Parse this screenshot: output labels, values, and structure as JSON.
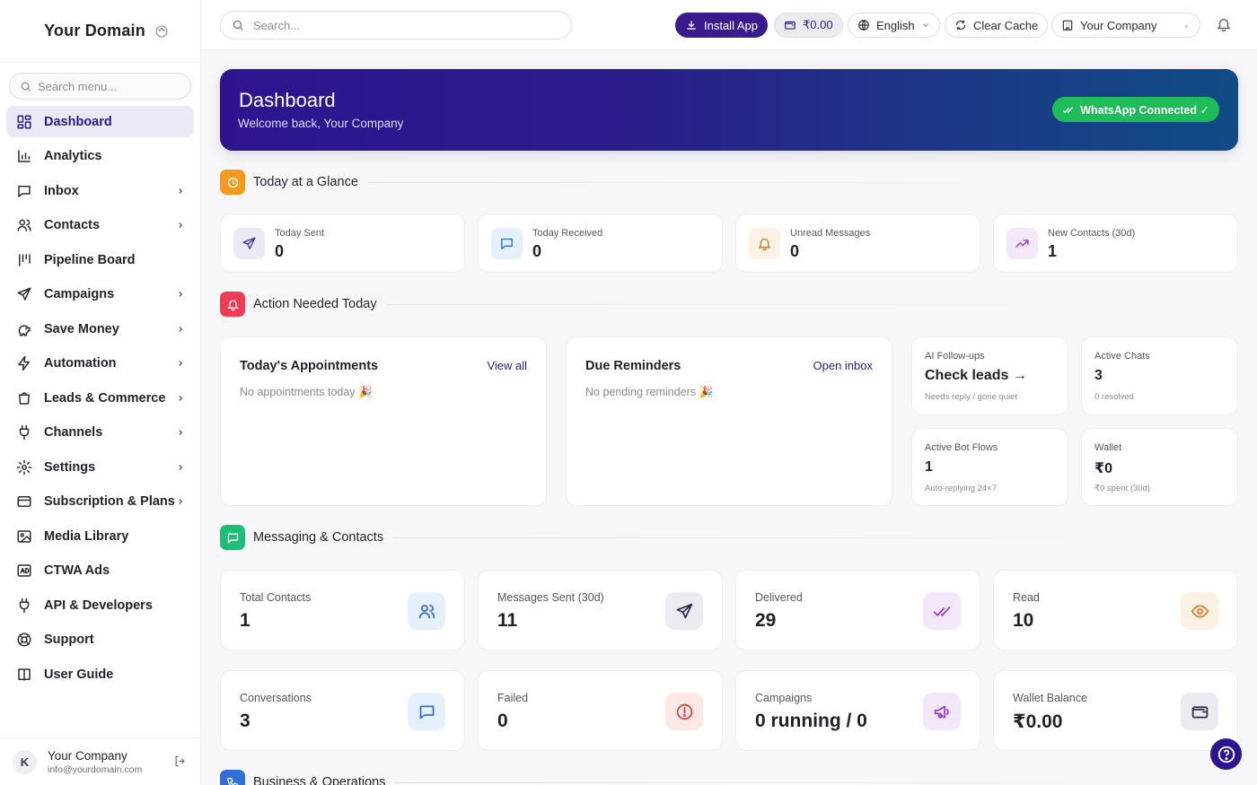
{
  "brand": {
    "name": "Your Domain"
  },
  "menu_search": {
    "placeholder": "Search menu..."
  },
  "nav": [
    {
      "label": "Dashboard",
      "icon": "dashboard-icon",
      "active": true,
      "chevron": false
    },
    {
      "label": "Analytics",
      "icon": "bar-chart-icon",
      "chevron": false
    },
    {
      "label": "Inbox",
      "icon": "chat-bubble-icon",
      "chevron": true
    },
    {
      "label": "Contacts",
      "icon": "users-icon",
      "chevron": true
    },
    {
      "label": "Pipeline Board",
      "icon": "pipeline-icon",
      "chevron": false
    },
    {
      "label": "Campaigns",
      "icon": "send-icon",
      "chevron": true
    },
    {
      "label": "Save Money",
      "icon": "piggy-bank-icon",
      "chevron": true
    },
    {
      "label": "Automation",
      "icon": "bolt-icon",
      "chevron": true
    },
    {
      "label": "Leads & Commerce",
      "icon": "shopping-bag-icon",
      "chevron": true
    },
    {
      "label": "Channels",
      "icon": "plug-icon",
      "chevron": true
    },
    {
      "label": "Settings",
      "icon": "gear-icon",
      "chevron": true
    },
    {
      "label": "Subscription & Plans",
      "icon": "credit-card-icon",
      "chevron": true
    },
    {
      "label": "Media Library",
      "icon": "image-icon",
      "chevron": false
    },
    {
      "label": "CTWA Ads",
      "icon": "ads-icon",
      "chevron": false
    },
    {
      "label": "API & Developers",
      "icon": "plug-icon",
      "chevron": false
    },
    {
      "label": "Support",
      "icon": "lifebuoy-icon",
      "chevron": false
    },
    {
      "label": "User Guide",
      "icon": "book-icon",
      "chevron": false
    }
  ],
  "user": {
    "initial": "K",
    "name": "Your Company",
    "email": "info@yourdomain.com"
  },
  "topbar": {
    "search_placeholder": "Search...",
    "install_label": "Install App",
    "wallet_label": "₹0.00",
    "language_label": "English",
    "clear_cache_label": "Clear Cache",
    "company_label": "Your Company"
  },
  "hero": {
    "title": "Dashboard",
    "subtitle": "Welcome back, Your Company",
    "badge": "WhatsApp Connected ✓"
  },
  "sections": {
    "glance": "Today at a Glance",
    "action": "Action Needed Today",
    "messaging": "Messaging & Contacts",
    "business": "Business & Operations"
  },
  "glance_cards": [
    {
      "label": "Today Sent",
      "value": "0",
      "icon": "send-icon",
      "color": "#4b3a9a",
      "bg": "#ebe9f5"
    },
    {
      "label": "Today Received",
      "value": "0",
      "icon": "chat-bubble-icon",
      "color": "#2f6fd6",
      "bg": "#e6effc"
    },
    {
      "label": "Unread Messages",
      "value": "0",
      "icon": "bell-icon",
      "color": "#e07a1f",
      "bg": "#fdf0e4"
    },
    {
      "label": "New Contacts (30d)",
      "value": "1",
      "icon": "trend-up-icon",
      "color": "#9b3ad6",
      "bg": "#f3e8fb"
    }
  ],
  "appointments": {
    "title": "Today's Appointments",
    "link": "View all",
    "empty": "No appointments today 🎉"
  },
  "reminders": {
    "title": "Due Reminders",
    "link": "Open inbox",
    "empty": "No pending reminders 🎉"
  },
  "mini_cards": [
    {
      "label": "AI Follow-ups",
      "value": "Check leads →",
      "sub": "Needs reply / gone quiet"
    },
    {
      "label": "Active Chats",
      "value": "3",
      "sub": "0 resolved"
    },
    {
      "label": "Active Bot Flows",
      "value": "1",
      "sub": "Auto-replying 24×7"
    },
    {
      "label": "Wallet",
      "value": "₹0",
      "sub": "₹0 spent (30d)"
    }
  ],
  "stat_cards": [
    {
      "label": "Total Contacts",
      "value": "1",
      "icon": "users-icon",
      "color": "#2f6fd6",
      "bg": "#e6effc"
    },
    {
      "label": "Messages Sent (30d)",
      "value": "11",
      "icon": "send-icon",
      "color": "#2d2d4a",
      "bg": "#ebebf2"
    },
    {
      "label": "Delivered",
      "value": "29",
      "icon": "double-check-icon",
      "color": "#9b3ad6",
      "bg": "#f3e8fb"
    },
    {
      "label": "Read",
      "value": "10",
      "icon": "eye-icon",
      "color": "#e07a1f",
      "bg": "#fdf0e4"
    },
    {
      "label": "Conversations",
      "value": "3",
      "icon": "chat-bubble-icon",
      "color": "#2f6fd6",
      "bg": "#e6effc"
    },
    {
      "label": "Failed",
      "value": "0",
      "icon": "alert-circle-icon",
      "color": "#e03a3a",
      "bg": "#fde8e8"
    },
    {
      "label": "Campaigns",
      "value": "0 running / 0",
      "icon": "megaphone-icon",
      "color": "#9b3ad6",
      "bg": "#f3e8fb"
    },
    {
      "label": "Wallet Balance",
      "value": "₹0.00",
      "icon": "wallet-icon",
      "color": "#2d2d4a",
      "bg": "#ebebf2"
    }
  ],
  "colors": {
    "accent": "#2d1a86",
    "hero_start": "#2e1390",
    "hero_end": "#0f4c86",
    "whatsapp_green": "#1fbd5a",
    "glance_icon": "#f59a1e",
    "action_icon": "#ef3b55",
    "messaging_icon": "#1fbd7a",
    "business_icon": "#2f6fd6"
  }
}
